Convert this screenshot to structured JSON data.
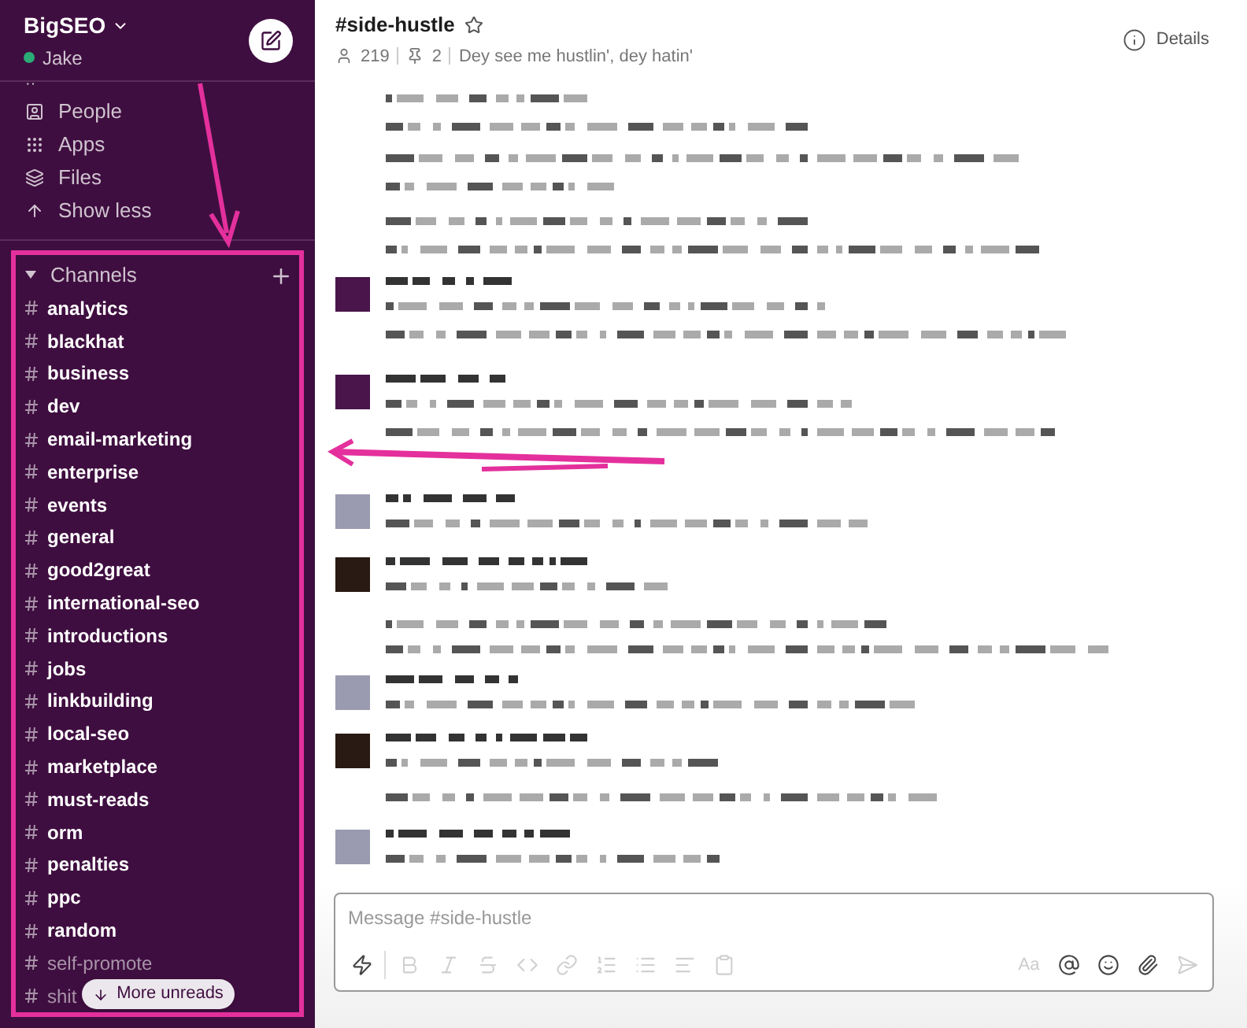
{
  "workspace": {
    "name": "BigSEO",
    "user": "Jake",
    "online": true
  },
  "sidebar": {
    "cut_item": "··",
    "items": [
      {
        "kind": "people",
        "label": "People"
      },
      {
        "kind": "apps",
        "label": "Apps"
      },
      {
        "kind": "files",
        "label": "Files"
      },
      {
        "kind": "less",
        "label": "Show less"
      }
    ],
    "channels_header": {
      "label": "Channels",
      "expanded": true
    },
    "channels": [
      {
        "name": "analytics",
        "unread": true
      },
      {
        "name": "blackhat",
        "unread": true
      },
      {
        "name": "business",
        "unread": true
      },
      {
        "name": "dev",
        "unread": true
      },
      {
        "name": "email-marketing",
        "unread": true
      },
      {
        "name": "enterprise",
        "unread": true
      },
      {
        "name": "events",
        "unread": true
      },
      {
        "name": "general",
        "unread": true
      },
      {
        "name": "good2great",
        "unread": true
      },
      {
        "name": "international-seo",
        "unread": true
      },
      {
        "name": "introductions",
        "unread": true
      },
      {
        "name": "jobs",
        "unread": true
      },
      {
        "name": "linkbuilding",
        "unread": true
      },
      {
        "name": "local-seo",
        "unread": true
      },
      {
        "name": "marketplace",
        "unread": true
      },
      {
        "name": "must-reads",
        "unread": true
      },
      {
        "name": "orm",
        "unread": true
      },
      {
        "name": "penalties",
        "unread": true
      },
      {
        "name": "ppc",
        "unread": true
      },
      {
        "name": "random",
        "unread": true
      },
      {
        "name": "self-promote",
        "unread": false
      },
      {
        "name": "shit",
        "unread": false
      }
    ],
    "more_unreads": "More unreads"
  },
  "channel": {
    "title": "#side-hustle",
    "starred": false,
    "members": "219",
    "pins": "2",
    "topic": "Dey see me hustlin', dey hatin'",
    "details": "Details"
  },
  "composer": {
    "placeholder": "Message #side-hustle",
    "format_label": "Aa",
    "tools": [
      {
        "kind": "shortcuts",
        "disabled": false
      },
      {
        "kind": "bold",
        "disabled": true
      },
      {
        "kind": "italic",
        "disabled": true
      },
      {
        "kind": "strike",
        "disabled": true
      },
      {
        "kind": "code",
        "disabled": true
      },
      {
        "kind": "link",
        "disabled": true
      },
      {
        "kind": "ordered",
        "disabled": true
      },
      {
        "kind": "bullets",
        "disabled": true
      },
      {
        "kind": "quote",
        "disabled": true
      },
      {
        "kind": "codeblock",
        "disabled": true
      }
    ],
    "actions": [
      {
        "kind": "mention",
        "disabled": false
      },
      {
        "kind": "emoji",
        "disabled": false
      },
      {
        "kind": "attach",
        "disabled": false
      },
      {
        "kind": "send",
        "disabled": true
      }
    ]
  }
}
